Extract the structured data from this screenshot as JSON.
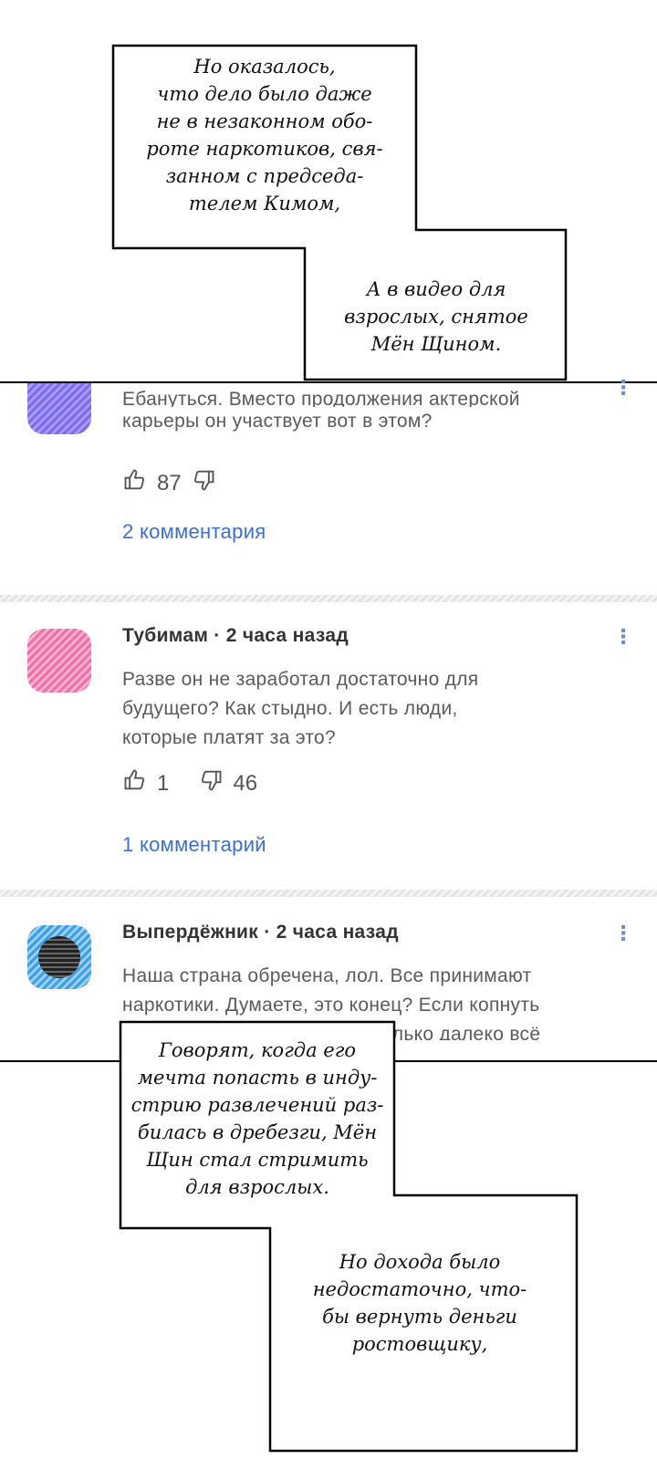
{
  "panel1": {
    "box1_lines": [
      "Но оказалось,",
      "что дело было даже",
      "не в незаконном обо-",
      "роте наркотиков, свя-",
      "занном с председа-",
      "телем Кимом,"
    ],
    "box2_lines": [
      "А в видео для",
      "взрослых, снятое",
      "Мён Щином."
    ]
  },
  "comments": [
    {
      "avatar_color": "#7b6cf0",
      "meta": "",
      "body_lines": [
        "Ебануться. Вместо продолжения актерской",
        "карьеры он участвует вот в этом?"
      ],
      "likes": "87",
      "dislikes": "",
      "replies": "2 комментария"
    },
    {
      "avatar_color": "#f36fa8",
      "meta": "Тубимам · 2 часа назад",
      "body_lines": [
        "Разве он не заработал достаточно для",
        "будущего? Как стыдно. И есть люди,",
        "которые платят за это?"
      ],
      "likes": "1",
      "dislikes": "46",
      "replies": "1 комментарий",
      "menu": "⋮"
    },
    {
      "avatar_color": "#3aa0e8",
      "meta": "Выпердёжник · 2 часа назад",
      "body_lines": [
        "Наша страна обречена, лол. Все принимают",
        "наркотики. Думаете, это конец? Если копнуть",
        "глубже, то станет ясно, насколько далеко всё"
      ],
      "menu": "⋮"
    }
  ],
  "panel2": {
    "box1_lines": [
      "Говорят, когда его",
      "мечта попасть в инду-",
      "стрию развлечений раз-",
      "билась в дребезги, Мён",
      "Щин стал стримить",
      "для взрослых."
    ],
    "box2_lines": [
      "Но дохода было",
      "недостаточно, что-",
      "бы вернуть деньги",
      "ростовщику,"
    ]
  },
  "icons": {
    "like": "thumbs-up-icon",
    "dislike": "thumbs-down-icon",
    "menu": "more-vert-icon"
  }
}
